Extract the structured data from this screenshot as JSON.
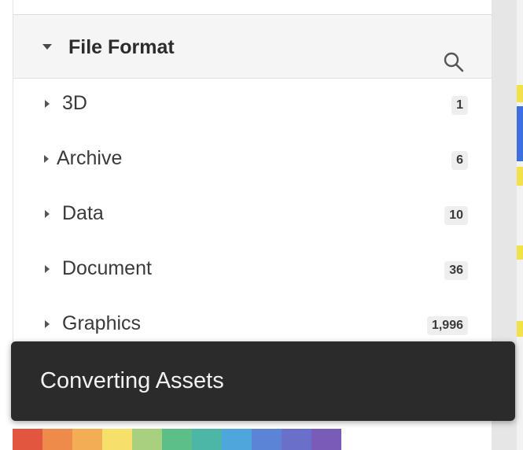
{
  "filter_panel": {
    "title": "File Format",
    "items": [
      {
        "label": "3D",
        "count": "1"
      },
      {
        "label": "Archive",
        "count": "6"
      },
      {
        "label": "Data",
        "count": "10"
      },
      {
        "label": "Document",
        "count": "36"
      },
      {
        "label": "Graphics",
        "count": "1,996"
      }
    ]
  },
  "toast": {
    "message": "Converting Assets"
  },
  "colors": {
    "toast_bg": "#2b2b2b",
    "header_bg": "#f5f5f5",
    "count_badge_bg": "#eeeeee",
    "accent_yellow": "#f2e24a",
    "accent_blue": "#3d6fe0"
  },
  "icons": {
    "collapse": "caret-down-icon",
    "search": "search-icon",
    "expand": "caret-right-icon"
  }
}
